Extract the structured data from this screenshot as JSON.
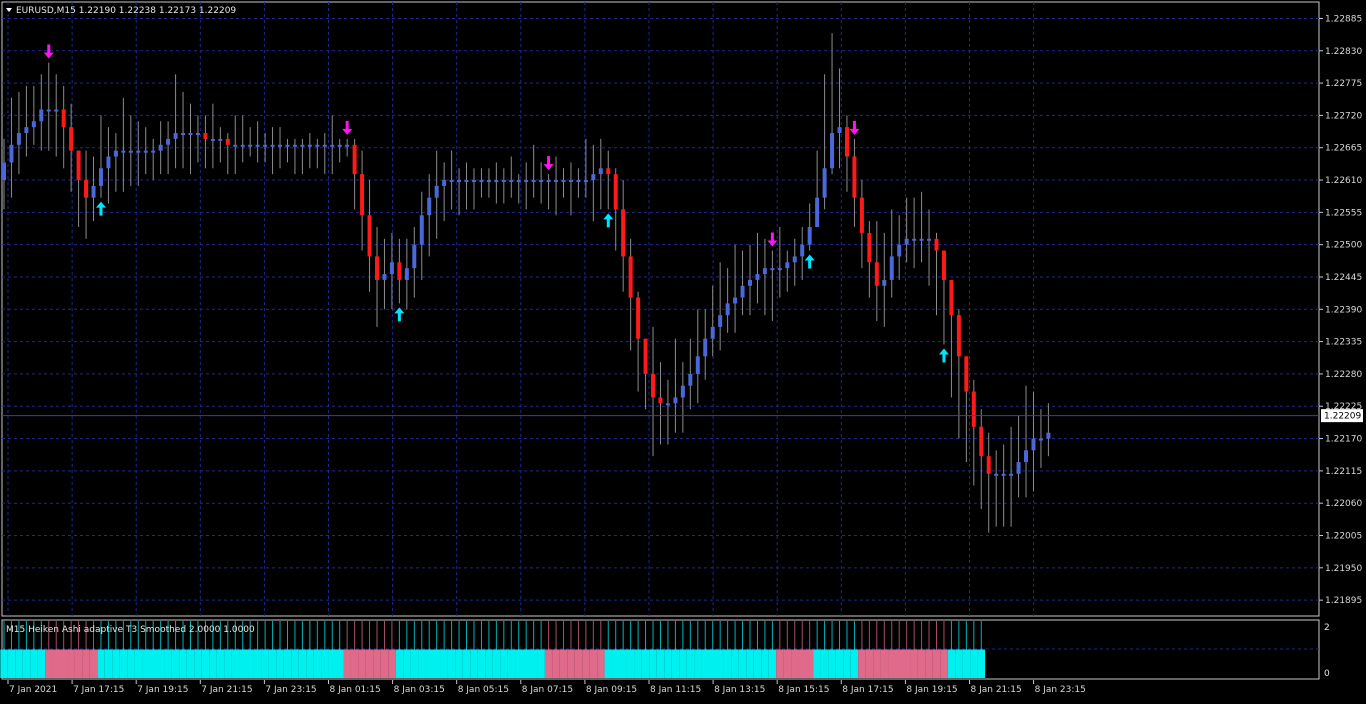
{
  "window": {
    "symbol_line": "EURUSD,M15  1.22190 1.22238 1.22173 1.22209",
    "current_price": "1.22209",
    "indicator_label": "M15 Heiken Ashi adaptive T3 Smoothed 2.0000 1.0000",
    "indicator_scale_top": "2",
    "indicator_scale_bottom": "0"
  },
  "colors": {
    "background": "#000000",
    "grid": "#1f2a8a",
    "bull_candle": "#4a68d8",
    "bear_candle": "#ff1a1a",
    "wick": "#8c8c8c",
    "buy_arrow": "#00e5ff",
    "sell_arrow": "#ff14f0",
    "hist_bull": "#00f0f0",
    "hist_bear": "#e06a8a",
    "text": "#d8d8d8"
  },
  "chart_data": {
    "type": "candlestick",
    "title": "EURUSD,M15",
    "ylim": [
      1.21868,
      1.22913
    ],
    "y_ticks": [
      "1.22885",
      "1.22830",
      "1.22775",
      "1.22720",
      "1.22665",
      "1.22610",
      "1.22555",
      "1.22500",
      "1.22445",
      "1.22390",
      "1.22335",
      "1.22280",
      "1.22225",
      "1.22170",
      "1.22115",
      "1.22060",
      "1.22005",
      "1.21950",
      "1.21895"
    ],
    "x_ticks": [
      "7 Jan 2021",
      "7 Jan 17:15",
      "7 Jan 19:15",
      "7 Jan 21:15",
      "7 Jan 23:15",
      "8 Jan 01:15",
      "8 Jan 03:15",
      "8 Jan 05:15",
      "8 Jan 07:15",
      "8 Jan 09:15",
      "8 Jan 11:15",
      "8 Jan 13:15",
      "8 Jan 15:15",
      "8 Jan 17:15",
      "8 Jan 19:15",
      "8 Jan 21:15",
      "8 Jan 23:15"
    ],
    "grid": true,
    "current_price": 1.22209,
    "ha_close": [
      1.2264,
      1.2267,
      1.2269,
      1.227,
      1.2271,
      1.2273,
      1.2273,
      1.2273,
      1.227,
      1.2266,
      1.2261,
      1.2258,
      1.226,
      1.2263,
      1.2265,
      1.2266,
      1.2266,
      1.2266,
      1.2266,
      1.2266,
      1.2266,
      1.2267,
      1.2268,
      1.2269,
      1.2269,
      1.2269,
      1.2269,
      1.2268,
      1.2268,
      1.2268,
      1.2267,
      1.2267,
      1.2267,
      1.2267,
      1.2267,
      1.2267,
      1.2267,
      1.2267,
      1.2267,
      1.2267,
      1.2267,
      1.2267,
      1.2267,
      1.2267,
      1.2267,
      1.2267,
      1.2267,
      1.2262,
      1.2255,
      1.2248,
      1.2244,
      1.2245,
      1.2247,
      1.2244,
      1.2246,
      1.225,
      1.2255,
      1.2258,
      1.226,
      1.2261,
      1.2261,
      1.2261,
      1.2261,
      1.2261,
      1.2261,
      1.2261,
      1.2261,
      1.2261,
      1.2261,
      1.2261,
      1.2261,
      1.2261,
      1.2261,
      1.2261,
      1.2261,
      1.2261,
      1.2261,
      1.2261,
      1.2261,
      1.2262,
      1.2263,
      1.2262,
      1.2256,
      1.2248,
      1.2241,
      1.2234,
      1.2228,
      1.2224,
      1.2223,
      1.2223,
      1.2224,
      1.2226,
      1.2228,
      1.2231,
      1.2234,
      1.2236,
      1.2238,
      1.224,
      1.2241,
      1.2243,
      1.2244,
      1.2245,
      1.2246,
      1.2246,
      1.2246,
      1.2247,
      1.2248,
      1.225,
      1.2253,
      1.2258,
      1.2263,
      1.2269,
      1.227,
      1.2265,
      1.2258,
      1.2252,
      1.2247,
      1.2243,
      1.2244,
      1.2248,
      1.225,
      1.2251,
      1.2251,
      1.2251,
      1.2251,
      1.2249,
      1.2244,
      1.2238,
      1.2231,
      1.2225,
      1.2219,
      1.2214,
      1.2211,
      1.2211,
      1.2211,
      1.2211,
      1.2213,
      1.2215,
      1.2217,
      1.2217,
      1.2218
    ],
    "ha_open": [
      1.2261,
      1.2264,
      1.2267,
      1.2269,
      1.227,
      1.2271,
      1.2273,
      1.2273,
      1.2273,
      1.227,
      1.2266,
      1.2261,
      1.2258,
      1.226,
      1.2263,
      1.2265,
      1.2266,
      1.2266,
      1.2266,
      1.2266,
      1.2266,
      1.2266,
      1.2267,
      1.2268,
      1.2269,
      1.2269,
      1.2269,
      1.2269,
      1.2268,
      1.2268,
      1.2268,
      1.2267,
      1.2267,
      1.2267,
      1.2267,
      1.2267,
      1.2267,
      1.2267,
      1.2267,
      1.2267,
      1.2267,
      1.2267,
      1.2267,
      1.2267,
      1.2267,
      1.2267,
      1.2267,
      1.2267,
      1.2262,
      1.2255,
      1.2248,
      1.2244,
      1.2245,
      1.2247,
      1.2244,
      1.2246,
      1.225,
      1.2255,
      1.2258,
      1.226,
      1.2261,
      1.2261,
      1.2261,
      1.2261,
      1.2261,
      1.2261,
      1.2261,
      1.2261,
      1.2261,
      1.2261,
      1.2261,
      1.2261,
      1.2261,
      1.2261,
      1.2261,
      1.2261,
      1.2261,
      1.2261,
      1.2261,
      1.2261,
      1.2262,
      1.2263,
      1.2262,
      1.2256,
      1.2248,
      1.2241,
      1.2234,
      1.2228,
      1.2224,
      1.2223,
      1.2223,
      1.2224,
      1.2226,
      1.2228,
      1.2231,
      1.2234,
      1.2236,
      1.2238,
      1.224,
      1.2241,
      1.2243,
      1.2244,
      1.2245,
      1.2246,
      1.2246,
      1.2246,
      1.2247,
      1.2248,
      1.225,
      1.2253,
      1.2258,
      1.2263,
      1.2269,
      1.227,
      1.2265,
      1.2258,
      1.2252,
      1.2247,
      1.2243,
      1.2244,
      1.2248,
      1.225,
      1.2251,
      1.2251,
      1.2251,
      1.2251,
      1.2249,
      1.2244,
      1.2238,
      1.2231,
      1.2225,
      1.2219,
      1.2214,
      1.2211,
      1.2211,
      1.2211,
      1.2211,
      1.2213,
      1.2215,
      1.2217,
      1.2217
    ],
    "ha_high": [
      1.2268,
      1.2275,
      1.2276,
      1.2277,
      1.2277,
      1.2279,
      1.2281,
      1.2279,
      1.2277,
      1.2274,
      1.2266,
      1.2266,
      1.2265,
      1.2272,
      1.227,
      1.2269,
      1.2275,
      1.2272,
      1.2271,
      1.227,
      1.2268,
      1.2271,
      1.2271,
      1.2279,
      1.2276,
      1.2274,
      1.2272,
      1.2272,
      1.2274,
      1.227,
      1.2269,
      1.2272,
      1.2272,
      1.227,
      1.2271,
      1.2269,
      1.227,
      1.227,
      1.2268,
      1.2268,
      1.2268,
      1.2269,
      1.2268,
      1.2269,
      1.2272,
      1.2268,
      1.2268,
      1.2268,
      1.2266,
      1.2261,
      1.2253,
      1.2251,
      1.2252,
      1.2251,
      1.2251,
      1.2253,
      1.2259,
      1.2262,
      1.2266,
      1.2264,
      1.2266,
      1.2263,
      1.2264,
      1.2263,
      1.2263,
      1.2263,
      1.2264,
      1.2263,
      1.2265,
      1.2262,
      1.2264,
      1.2267,
      1.2264,
      1.2262,
      1.2265,
      1.2263,
      1.2264,
      1.2263,
      1.2268,
      1.2267,
      1.2268,
      1.2266,
      1.2263,
      1.2261,
      1.2251,
      1.2242,
      1.2234,
      1.2236,
      1.223,
      1.2227,
      1.2234,
      1.223,
      1.2234,
      1.2239,
      1.2239,
      1.2243,
      1.2247,
      1.2246,
      1.225,
      1.2249,
      1.225,
      1.2252,
      1.2251,
      1.2249,
      1.2253,
      1.2249,
      1.2251,
      1.2253,
      1.2257,
      1.2266,
      1.2279,
      1.2286,
      1.228,
      1.2272,
      1.2268,
      1.2261,
      1.2254,
      1.2254,
      1.2252,
      1.2256,
      1.2255,
      1.2258,
      1.2258,
      1.2259,
      1.2256,
      1.2252,
      1.2248,
      1.2241,
      1.2239,
      1.223,
      1.2227,
      1.2222,
      1.2218,
      1.2215,
      1.2216,
      1.2219,
      1.2221,
      1.2226,
      1.2225,
      1.2222,
      1.2223
    ],
    "ha_low": [
      1.2256,
      1.2258,
      1.2262,
      1.2265,
      1.2267,
      1.2266,
      1.2266,
      1.2265,
      1.2263,
      1.2259,
      1.2253,
      1.2251,
      1.2254,
      1.2258,
      1.2257,
      1.2259,
      1.2259,
      1.226,
      1.226,
      1.2262,
      1.2261,
      1.2262,
      1.2262,
      1.2263,
      1.2263,
      1.2262,
      1.2264,
      1.2263,
      1.2263,
      1.2264,
      1.2262,
      1.2262,
      1.2264,
      1.2265,
      1.2264,
      1.2264,
      1.2262,
      1.2263,
      1.2264,
      1.2262,
      1.2262,
      1.2263,
      1.2263,
      1.2262,
      1.2262,
      1.2264,
      1.2265,
      1.2256,
      1.2249,
      1.2242,
      1.2236,
      1.2239,
      1.2239,
      1.224,
      1.2239,
      1.2241,
      1.2244,
      1.2248,
      1.2251,
      1.2254,
      1.2256,
      1.2255,
      1.2256,
      1.2256,
      1.2258,
      1.2258,
      1.2257,
      1.2257,
      1.2258,
      1.2257,
      1.2256,
      1.2258,
      1.2257,
      1.2256,
      1.2255,
      1.2258,
      1.2255,
      1.2258,
      1.2258,
      1.2254,
      1.2256,
      1.2256,
      1.2249,
      1.2242,
      1.2232,
      1.2225,
      1.2222,
      1.2214,
      1.2216,
      1.2216,
      1.2218,
      1.2218,
      1.2222,
      1.2223,
      1.2227,
      1.2231,
      1.2232,
      1.2235,
      1.2235,
      1.2238,
      1.2238,
      1.224,
      1.2238,
      1.2237,
      1.2241,
      1.2242,
      1.2243,
      1.2244,
      1.2249,
      1.2253,
      1.2256,
      1.2262,
      1.2263,
      1.2259,
      1.2253,
      1.2246,
      1.2241,
      1.2237,
      1.2236,
      1.2241,
      1.2244,
      1.2247,
      1.2246,
      1.2247,
      1.2243,
      1.2238,
      1.2233,
      1.2224,
      1.2217,
      1.2213,
      1.2209,
      1.2205,
      1.2201,
      1.2202,
      1.2202,
      1.2202,
      1.2207,
      1.2207,
      1.2208,
      1.2212,
      1.2214
    ],
    "signals": [
      {
        "type": "sell",
        "bar": 6
      },
      {
        "type": "buy",
        "bar": 13
      },
      {
        "type": "sell",
        "bar": 46
      },
      {
        "type": "buy",
        "bar": 53
      },
      {
        "type": "sell",
        "bar": 73
      },
      {
        "type": "buy",
        "bar": 81
      },
      {
        "type": "sell",
        "bar": 103
      },
      {
        "type": "buy",
        "bar": 108
      },
      {
        "type": "sell",
        "bar": 114
      },
      {
        "type": "buy",
        "bar": 126
      }
    ],
    "indicator": {
      "name": "M15 Heiken Ashi adaptive T3 Smoothed 2.0000 1.0000",
      "ylim": [
        0,
        2
      ],
      "trend": [
        1,
        1,
        1,
        1,
        1,
        1,
        -1,
        -1,
        -1,
        -1,
        -1,
        -1,
        -1,
        1,
        1,
        1,
        1,
        1,
        1,
        1,
        1,
        1,
        1,
        1,
        1,
        1,
        1,
        1,
        1,
        1,
        1,
        1,
        1,
        1,
        1,
        1,
        1,
        1,
        1,
        1,
        1,
        1,
        1,
        1,
        1,
        1,
        -1,
        -1,
        -1,
        -1,
        -1,
        -1,
        -1,
        1,
        1,
        1,
        1,
        1,
        1,
        1,
        1,
        1,
        1,
        1,
        1,
        1,
        1,
        1,
        1,
        1,
        1,
        1,
        1,
        -1,
        -1,
        -1,
        -1,
        -1,
        -1,
        -1,
        -1,
        1,
        1,
        1,
        1,
        1,
        1,
        1,
        1,
        1,
        1,
        1,
        1,
        1,
        1,
        1,
        1,
        1,
        1,
        1,
        1,
        1,
        1,
        1,
        -1,
        -1,
        -1,
        -1,
        -1,
        1,
        1,
        1,
        1,
        1,
        1,
        -1,
        -1,
        -1,
        -1,
        -1,
        -1,
        -1,
        -1,
        -1,
        -1,
        -1,
        -1,
        1,
        1,
        1,
        1,
        1
      ]
    }
  }
}
